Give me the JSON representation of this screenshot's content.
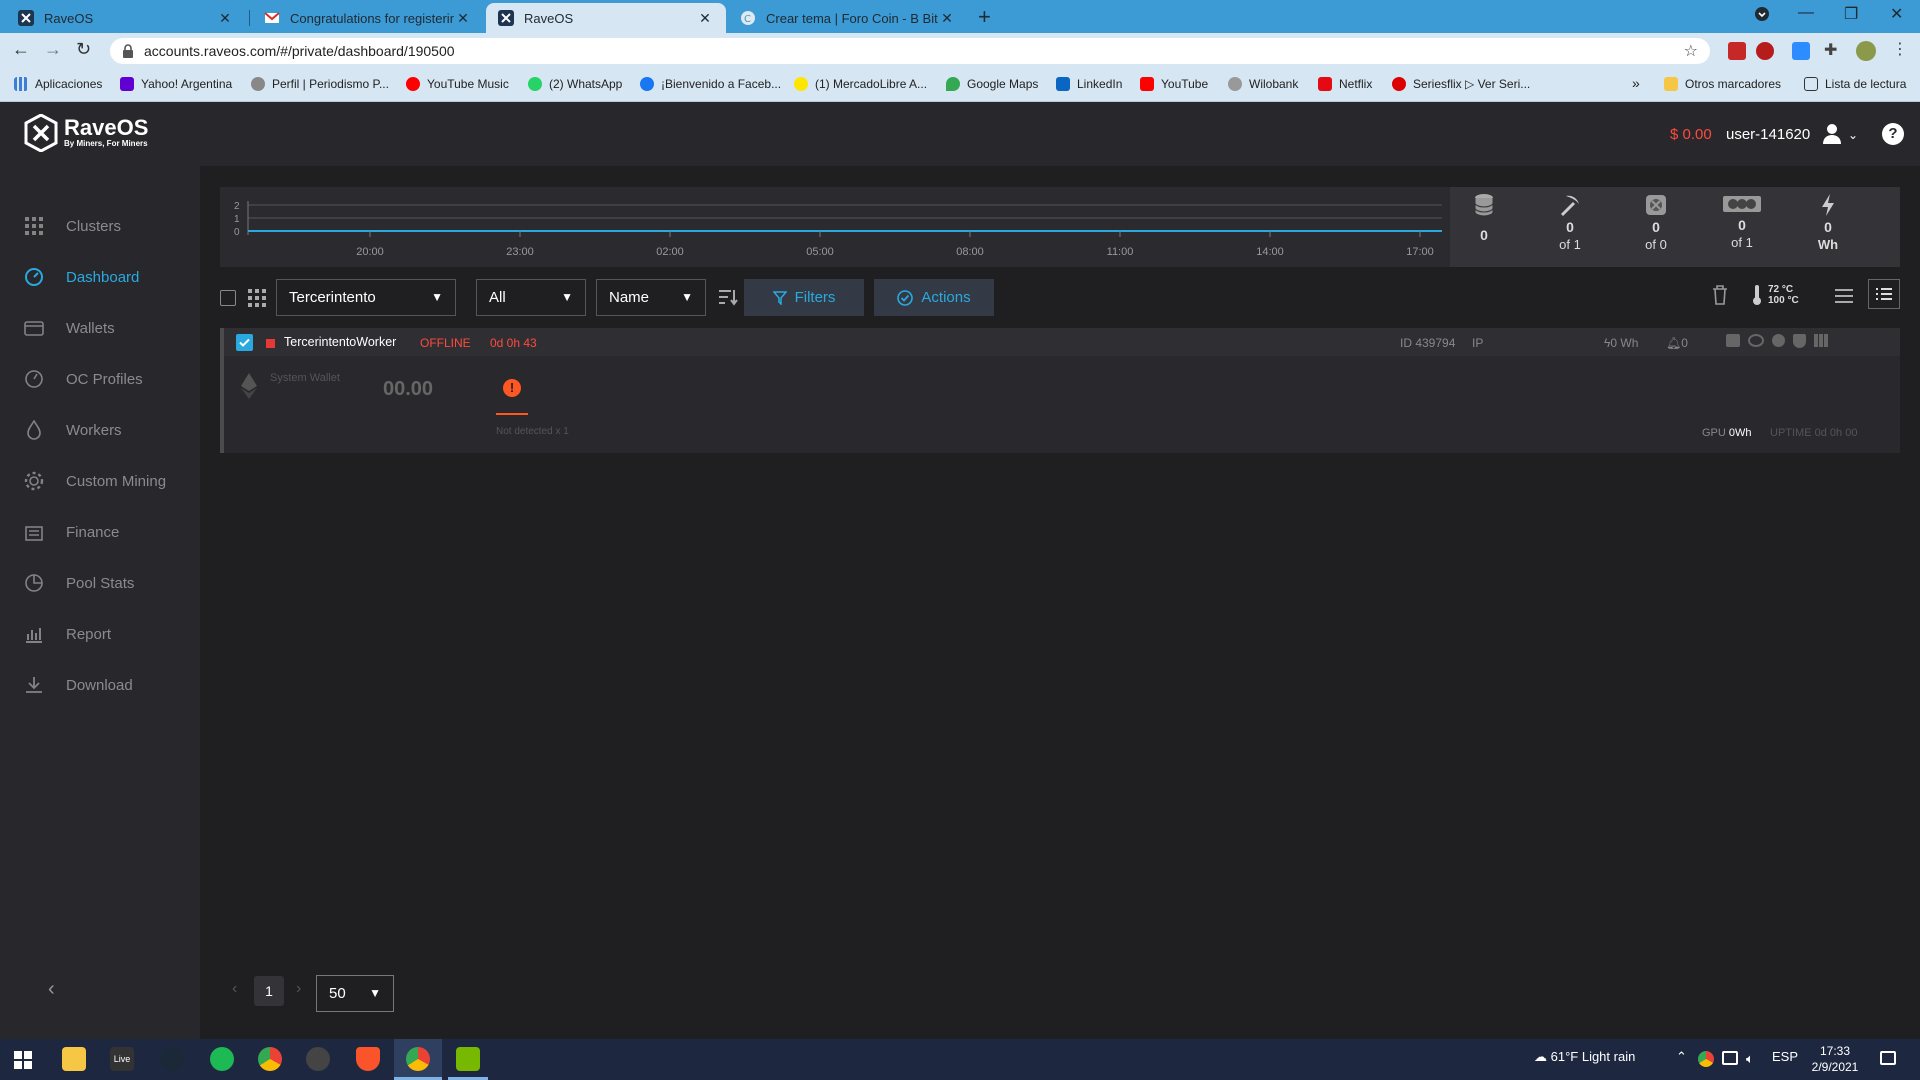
{
  "browser": {
    "tabs": [
      {
        "title": "RaveOS"
      },
      {
        "title": "Congratulations for registering y"
      },
      {
        "title": "RaveOS"
      },
      {
        "title": "Crear tema | Foro Coin - B Bitcoin"
      }
    ],
    "url": "accounts.raveos.com/#/private/dashboard/190500",
    "bookmarks": [
      "Aplicaciones",
      "Yahoo! Argentina",
      "Perfil | Periodismo P...",
      "YouTube Music",
      "(2) WhatsApp",
      "¡Bienvenido a Faceb...",
      "(1) MercadoLibre A...",
      "Google Maps",
      "LinkedIn",
      "YouTube",
      "Wilobank",
      "Netflix",
      "Seriesflix ▷ Ver Seri..."
    ],
    "other_bookmarks": "Otros marcadores",
    "reading_list": "Lista de lectura",
    "more": "»"
  },
  "app": {
    "brand": "RaveOS",
    "tagline": "By Miners, For Miners",
    "balance": "$ 0.00",
    "username": "user-141620",
    "sidebar": [
      {
        "label": "Clusters",
        "icon": "clusters-icon"
      },
      {
        "label": "Dashboard",
        "icon": "dashboard-icon",
        "active": true
      },
      {
        "label": "Wallets",
        "icon": "wallet-icon"
      },
      {
        "label": "OC Profiles",
        "icon": "gauge-icon"
      },
      {
        "label": "Workers",
        "icon": "flame-icon"
      },
      {
        "label": "Custom Mining",
        "icon": "gear-icon"
      },
      {
        "label": "Finance",
        "icon": "finance-icon"
      },
      {
        "label": "Pool Stats",
        "icon": "pie-icon"
      },
      {
        "label": "Report",
        "icon": "report-icon"
      },
      {
        "label": "Download",
        "icon": "download-icon"
      }
    ],
    "graph": {
      "y_ticks": [
        "2",
        "1",
        "0"
      ],
      "x_ticks": [
        "20:00",
        "23:00",
        "02:00",
        "05:00",
        "08:00",
        "11:00",
        "14:00",
        "17:00"
      ]
    },
    "stats": [
      {
        "icon": "coins-icon",
        "value": "0",
        "sub": ""
      },
      {
        "icon": "pickaxe-icon",
        "value": "0",
        "sub": "of 1"
      },
      {
        "icon": "asic-icon",
        "value": "0",
        "sub": "of 0"
      },
      {
        "icon": "gpu-icon",
        "value": "0",
        "sub": "of 1"
      },
      {
        "icon": "bolt-icon",
        "value": "0",
        "sub": "Wh"
      }
    ],
    "toolbar": {
      "group": "Tercerintento",
      "status_filter": "All",
      "sort_by": "Name",
      "filters": "Filters",
      "actions": "Actions",
      "temp_high": "72 °C",
      "temp_max": "100 °C"
    },
    "worker": {
      "name": "TercerintentoWorker",
      "status": "OFFLINE",
      "offline_time": "0d 0h 43",
      "id": "ID 439794",
      "ip": "IP",
      "power": "0 Wh",
      "alerts": "0",
      "wallet_label": "System Wallet",
      "hashrate": "00.00",
      "not_detected": "Not detected x 1",
      "gpu_label": "GPU",
      "gpu_power": "0Wh",
      "uptime": "UPTIME 0d 0h 00"
    },
    "pagination": {
      "page": "1",
      "per_page": "50"
    }
  },
  "taskbar": {
    "weather": "61°F  Light rain",
    "lang": "ESP",
    "time": "17:33",
    "date": "2/9/2021"
  }
}
